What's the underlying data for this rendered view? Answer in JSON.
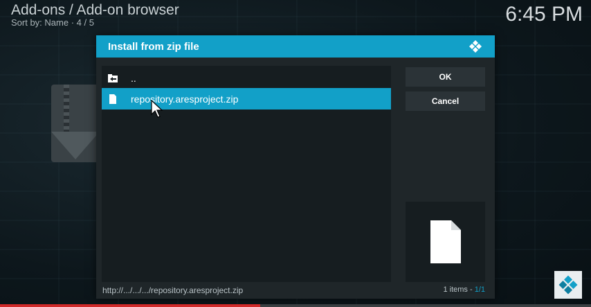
{
  "header": {
    "title": "Add-ons / Add-on browser",
    "subtitle": "Sort by: Name  ·  4 / 5",
    "clock": "6:45 PM"
  },
  "dialog": {
    "title": "Install from zip file",
    "items": [
      {
        "label": "..",
        "icon": "folder-up-icon",
        "selected": false
      },
      {
        "label": "repository.aresproject.zip",
        "icon": "file-icon",
        "selected": true
      }
    ],
    "buttons": {
      "ok": "OK",
      "cancel": "Cancel"
    },
    "path": "http://.../.../.../repository.aresproject.zip",
    "count_prefix": "1 items - ",
    "count_page": "1/1"
  },
  "colors": {
    "accent": "#12a0c8",
    "progress": "#d12a2a"
  },
  "progress": {
    "fraction": 0.44
  }
}
